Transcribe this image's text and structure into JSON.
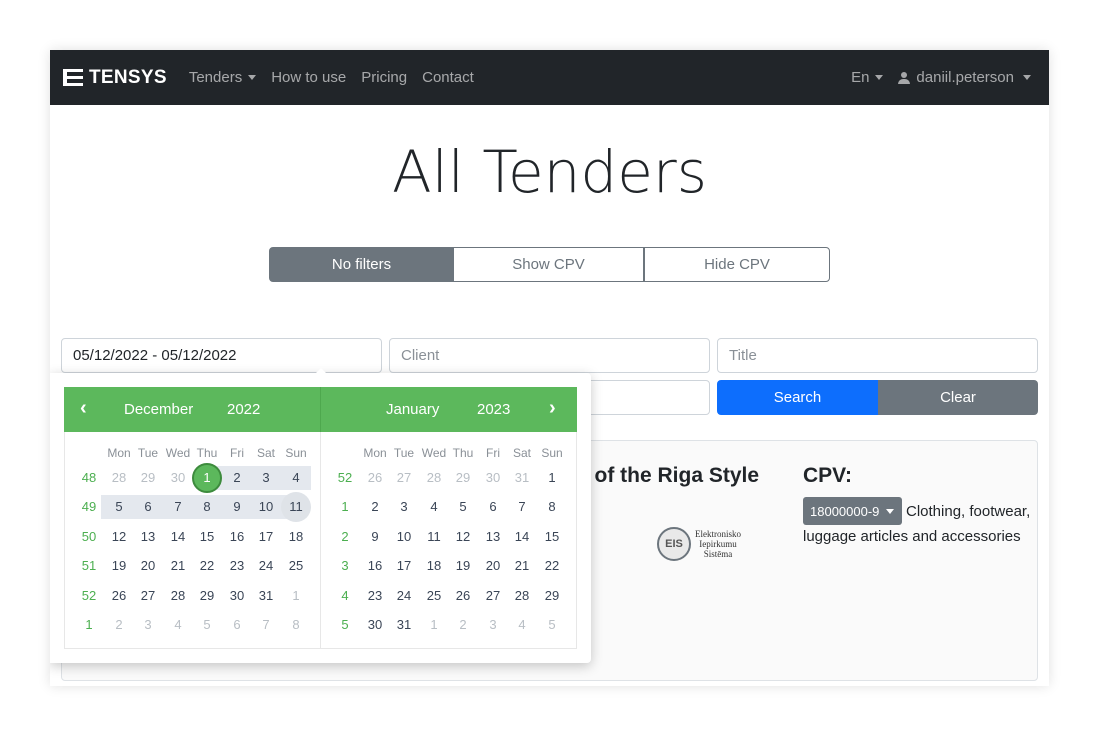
{
  "navbar": {
    "brand": "TENSYS",
    "links": [
      "Tenders",
      "How to use",
      "Pricing",
      "Contact"
    ],
    "language": "En",
    "user": "daniil.peterson"
  },
  "page": {
    "title": "All Tenders"
  },
  "filters": {
    "no_filters": "No filters",
    "show_cpv": "Show CPV",
    "hide_cpv": "Hide CPV"
  },
  "search": {
    "date_range": "05/12/2022 - 05/12/2022",
    "client_placeholder": "Client",
    "title_placeholder": "Title",
    "search_label": "Search",
    "clear_label": "Clear"
  },
  "card": {
    "title_fragment": "s of the Riga Style",
    "cpv_label": "CPV:",
    "cpv_code": "18000000-9",
    "cpv_description": "Clothing, footwear, luggage articles and accessories",
    "logo_text": [
      "Elektronisko",
      "Iepirkumu",
      "Sistēma"
    ],
    "logo_mark": "EIS"
  },
  "datepicker": {
    "prev": "‹",
    "next": "›",
    "left": {
      "month": "December",
      "year": "2022",
      "weekdays": [
        "Mon",
        "Tue",
        "Wed",
        "Thu",
        "Fri",
        "Sat",
        "Sun"
      ],
      "weeks": [
        {
          "wk": "48",
          "days": [
            [
              "28",
              1
            ],
            [
              "29",
              1
            ],
            [
              "30",
              1
            ],
            [
              "1",
              0
            ],
            [
              "2",
              0
            ],
            [
              "3",
              0
            ],
            [
              "4",
              0
            ]
          ]
        },
        {
          "wk": "49",
          "days": [
            [
              "5",
              0
            ],
            [
              "6",
              0
            ],
            [
              "7",
              0
            ],
            [
              "8",
              0
            ],
            [
              "9",
              0
            ],
            [
              "10",
              0
            ],
            [
              "11",
              0
            ]
          ]
        },
        {
          "wk": "50",
          "days": [
            [
              "12",
              0
            ],
            [
              "13",
              0
            ],
            [
              "14",
              0
            ],
            [
              "15",
              0
            ],
            [
              "16",
              0
            ],
            [
              "17",
              0
            ],
            [
              "18",
              0
            ]
          ]
        },
        {
          "wk": "51",
          "days": [
            [
              "19",
              0
            ],
            [
              "20",
              0
            ],
            [
              "21",
              0
            ],
            [
              "22",
              0
            ],
            [
              "23",
              0
            ],
            [
              "24",
              0
            ],
            [
              "25",
              0
            ]
          ]
        },
        {
          "wk": "52",
          "days": [
            [
              "26",
              0
            ],
            [
              "27",
              0
            ],
            [
              "28",
              0
            ],
            [
              "29",
              0
            ],
            [
              "30",
              0
            ],
            [
              "31",
              0
            ],
            [
              "1",
              1
            ]
          ]
        },
        {
          "wk": "1",
          "days": [
            [
              "2",
              1
            ],
            [
              "3",
              1
            ],
            [
              "4",
              1
            ],
            [
              "5",
              1
            ],
            [
              "6",
              1
            ],
            [
              "7",
              1
            ],
            [
              "8",
              1
            ]
          ]
        }
      ]
    },
    "right": {
      "month": "January",
      "year": "2023",
      "weekdays": [
        "Mon",
        "Tue",
        "Wed",
        "Thu",
        "Fri",
        "Sat",
        "Sun"
      ],
      "weeks": [
        {
          "wk": "52",
          "days": [
            [
              "26",
              1
            ],
            [
              "27",
              1
            ],
            [
              "28",
              1
            ],
            [
              "29",
              1
            ],
            [
              "30",
              1
            ],
            [
              "31",
              1
            ],
            [
              "1",
              0
            ]
          ]
        },
        {
          "wk": "1",
          "days": [
            [
              "2",
              0
            ],
            [
              "3",
              0
            ],
            [
              "4",
              0
            ],
            [
              "5",
              0
            ],
            [
              "6",
              0
            ],
            [
              "7",
              0
            ],
            [
              "8",
              0
            ]
          ]
        },
        {
          "wk": "2",
          "days": [
            [
              "9",
              0
            ],
            [
              "10",
              0
            ],
            [
              "11",
              0
            ],
            [
              "12",
              0
            ],
            [
              "13",
              0
            ],
            [
              "14",
              0
            ],
            [
              "15",
              0
            ]
          ]
        },
        {
          "wk": "3",
          "days": [
            [
              "16",
              0
            ],
            [
              "17",
              0
            ],
            [
              "18",
              0
            ],
            [
              "19",
              0
            ],
            [
              "20",
              0
            ],
            [
              "21",
              0
            ],
            [
              "22",
              0
            ]
          ]
        },
        {
          "wk": "4",
          "days": [
            [
              "23",
              0
            ],
            [
              "24",
              0
            ],
            [
              "25",
              0
            ],
            [
              "26",
              0
            ],
            [
              "27",
              0
            ],
            [
              "28",
              0
            ],
            [
              "29",
              0
            ]
          ]
        },
        {
          "wk": "5",
          "days": [
            [
              "30",
              0
            ],
            [
              "31",
              0
            ],
            [
              "1",
              1
            ],
            [
              "2",
              1
            ],
            [
              "3",
              1
            ],
            [
              "4",
              1
            ],
            [
              "5",
              1
            ]
          ]
        }
      ]
    }
  },
  "colors": {
    "accent": "#5cb85c",
    "primary": "#0d6efd",
    "secondary": "#6c757d",
    "navbar": "#212529"
  }
}
